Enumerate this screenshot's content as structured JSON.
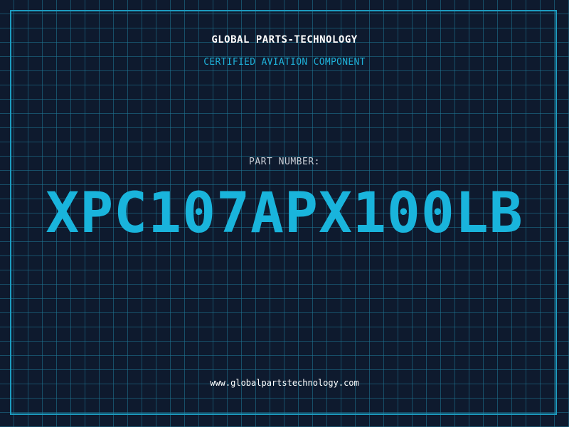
{
  "header": {
    "brand": "GLOBAL PARTS-TECHNOLOGY",
    "subtitle": "CERTIFIED AVIATION COMPONENT"
  },
  "part": {
    "label": "PART NUMBER:",
    "number": "XPC107APX100LB"
  },
  "footer": {
    "website": "www.globalpartstechnology.com"
  },
  "colors": {
    "background": "#0e1a2e",
    "grid": "#1f7896",
    "accent": "#19b4dc",
    "frame": "#1d9cc0"
  }
}
